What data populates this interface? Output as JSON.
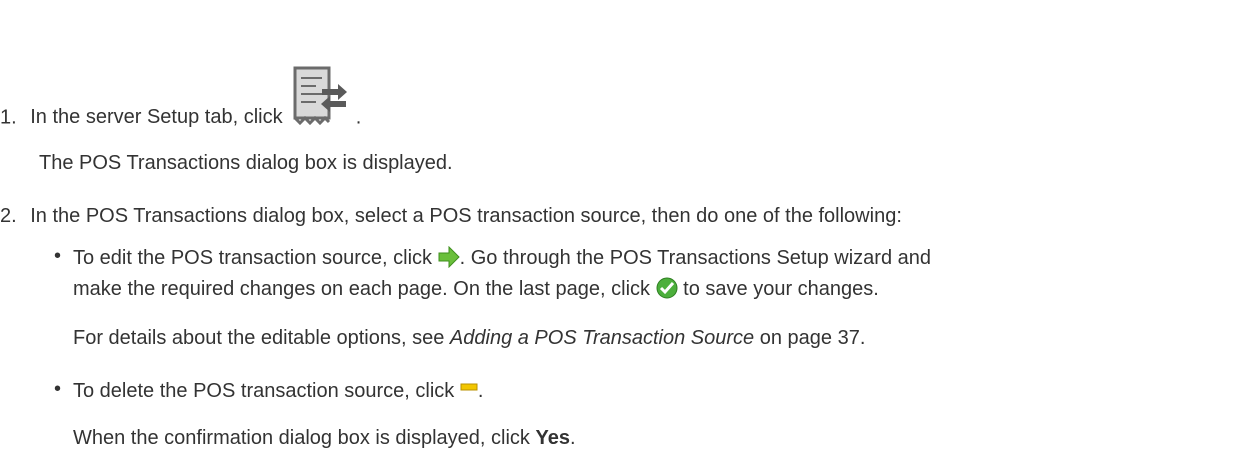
{
  "step1": {
    "number": "1.",
    "text_before": "In the server Setup tab, click",
    "text_after": ".",
    "icon": "pos-transactions-icon",
    "result": "The POS Transactions dialog box is displayed."
  },
  "step2": {
    "number": "2.",
    "text": "In the POS Transactions dialog box, select a POS transaction source, then do one of the following:"
  },
  "bullet1": {
    "line1_before": "To edit the POS transaction source, click",
    "line1_after": ". Go through the POS Transactions Setup wizard and",
    "line2_before": "make the required changes on each page. On the last page, click",
    "line2_after": "to save your changes.",
    "edit_icon": "green-arrow-icon",
    "save_icon": "green-check-icon",
    "details_before": "For details about the editable options, see",
    "details_link": "Adding a POS Transaction Source",
    "details_after": "on page 37."
  },
  "bullet2": {
    "text_before": "To delete the POS transaction source, click",
    "text_after": ".",
    "delete_icon": "yellow-minus-icon",
    "confirm_before": "When the confirmation dialog box is displayed, click",
    "confirm_bold": "Yes",
    "confirm_after": "."
  },
  "colors": {
    "text": "#333333",
    "arrow_green": "#6abf3b",
    "check_green": "#4caf3c",
    "minus_yellow": "#f2c600"
  }
}
